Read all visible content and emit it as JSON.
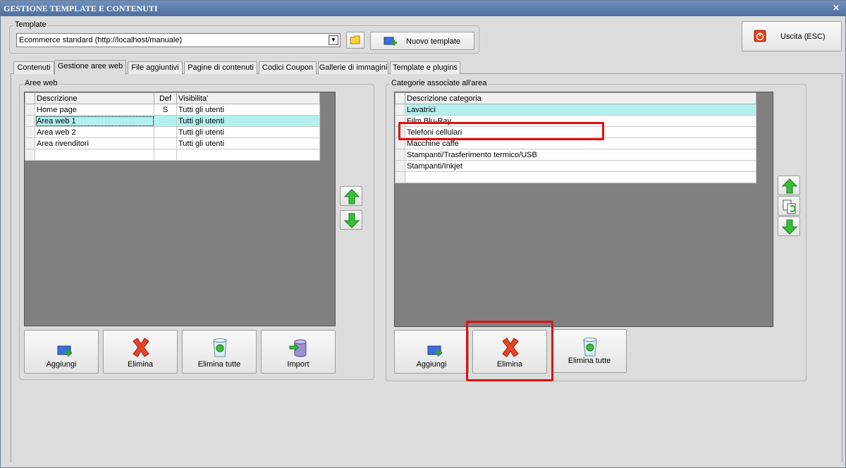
{
  "window": {
    "title": "GESTIONE TEMPLATE E CONTENUTI",
    "close_glyph": "×"
  },
  "template": {
    "group_label": "Template",
    "selected": "Ecommerce standard (http://localhost/manuale)",
    "new_button_label": "Nuovo template"
  },
  "exit_button_label": "Uscita (ESC)",
  "tabs": [
    {
      "label": "Contenuti"
    },
    {
      "label": "Gestione aree web",
      "active": true
    },
    {
      "label": "File aggiuntivi"
    },
    {
      "label": "Pagine di contenuti"
    },
    {
      "label": "Codici Coupon"
    },
    {
      "label": "Gallerie di immagini"
    },
    {
      "label": "Template e plugins"
    }
  ],
  "areas": {
    "group_label": "Aree web",
    "columns": [
      "Descrizione",
      "Def",
      "Visibilita'"
    ],
    "rows": [
      {
        "descrizione": "Home page",
        "def": "S",
        "visibilita": "Tutti gli utenti"
      },
      {
        "descrizione": "Area web 1",
        "def": "",
        "visibilita": "Tutti gli utenti"
      },
      {
        "descrizione": "Area web 2",
        "def": "",
        "visibilita": "Tutti gli utenti"
      },
      {
        "descrizione": "Area rivenditori",
        "def": "",
        "visibilita": "Tutti gli utenti"
      },
      {
        "descrizione": "",
        "def": "",
        "visibilita": ""
      }
    ],
    "selected_row": 1,
    "buttons": {
      "add": "Aggiungi",
      "delete": "Elimina",
      "delete_all": "Elimina tutte",
      "import": "Import"
    }
  },
  "categories": {
    "group_label": "Categorie associate all'area",
    "columns": [
      "Descrizione categoria"
    ],
    "rows": [
      "Lavatrici",
      "Film Blu-Ray",
      "Telefoni cellulari",
      "Macchine caffe",
      "Stampanti/Trasferimento termico/USB",
      "Stampanti/Inkjet",
      ""
    ],
    "selected_row": 0,
    "buttons": {
      "add": "Aggiungi",
      "delete": "Elimina",
      "delete_all": "Elimina tutte"
    }
  },
  "colors": {
    "selection": "#b2f0f0",
    "highlight": "#e01010",
    "title_bar": "#4e6fa0",
    "grid_background": "#808080"
  }
}
